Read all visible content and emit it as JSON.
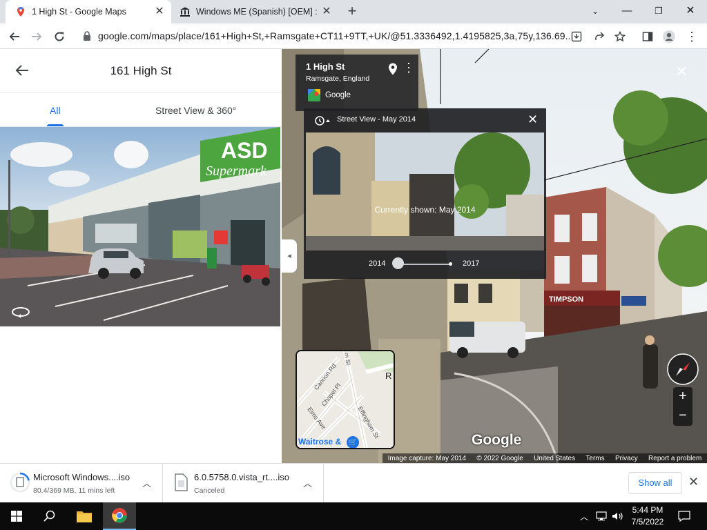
{
  "browser": {
    "tabs": [
      {
        "title": "1 High St - Google Maps",
        "active": true
      },
      {
        "title": "Windows ME (Spanish) [OEM] : M",
        "active": false
      }
    ],
    "url": "google.com/maps/place/161+High+St,+Ramsgate+CT11+9TT,+UK/@51.3336492,1.4195825,3a,75y,136.69..."
  },
  "panel": {
    "title": "161 High St",
    "tabs": [
      "All",
      "Street View & 360°"
    ]
  },
  "streetview": {
    "place_name": "1 High St",
    "place_sub": "Ramsgate, England",
    "source": "Google",
    "timemachine": {
      "label": "Street View - May 2014",
      "current": "Currently shown: May 2014",
      "year_start": "2014",
      "year_end": "2017",
      "slider_position": 0
    },
    "minimap": {
      "streets": [
        "Cannon Rd",
        "Chapel Pl",
        "Elms Ave",
        "Effingham St",
        "m St"
      ],
      "poi": "Waitrose &",
      "edge_label": "R"
    },
    "shop_sign": "TIMPSON",
    "watermark": "Google",
    "footer": [
      "Image capture: May 2014",
      "© 2022 Google",
      "United States",
      "Terms",
      "Privacy",
      "Report a problem"
    ],
    "zoom_in": "+",
    "zoom_out": "−"
  },
  "downloads": [
    {
      "name": "Microsoft Windows....iso",
      "status": "80.4/369 MB, 11 mins left",
      "progress": 0.218
    },
    {
      "name": "6.0.5758.0.vista_rt....iso",
      "status": "Canceled"
    }
  ],
  "downloads_show_all": "Show all",
  "taskbar": {
    "time": "5:44 PM",
    "date": "7/5/2022"
  },
  "colors": {
    "accent": "#1a73e8",
    "tabstrip": "#dee1e6",
    "taskbar": "#0b0b0b"
  }
}
